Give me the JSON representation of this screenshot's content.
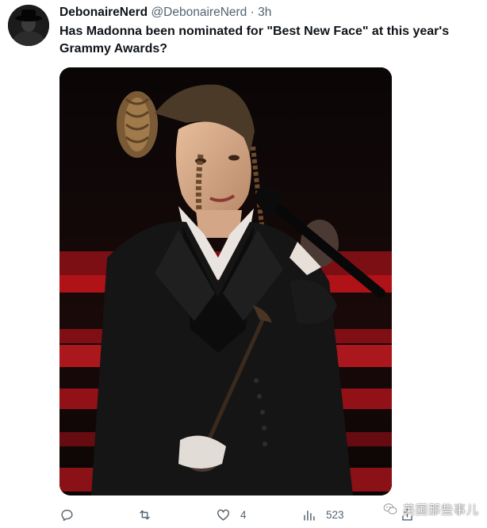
{
  "tweet": {
    "author_name": "DebonaireNerd",
    "handle": "@DebonaireNerd",
    "separator": "·",
    "time": "3h",
    "text": "Has Madonna been nominated for \"Best New Face\" at this year's Grammy Awards?"
  },
  "actions": {
    "reply": {
      "icon": "reply-icon"
    },
    "retweet": {
      "icon": "retweet-icon"
    },
    "like": {
      "icon": "heart-icon",
      "count": "4"
    },
    "views": {
      "icon": "views-icon",
      "count": "523"
    },
    "share": {
      "icon": "share-icon"
    }
  },
  "watermark": {
    "text": "英国那些事儿"
  },
  "colors": {
    "text_primary": "#0f1419",
    "text_secondary": "#536471",
    "stage_red": "#c0141a",
    "background": "#ffffff"
  }
}
